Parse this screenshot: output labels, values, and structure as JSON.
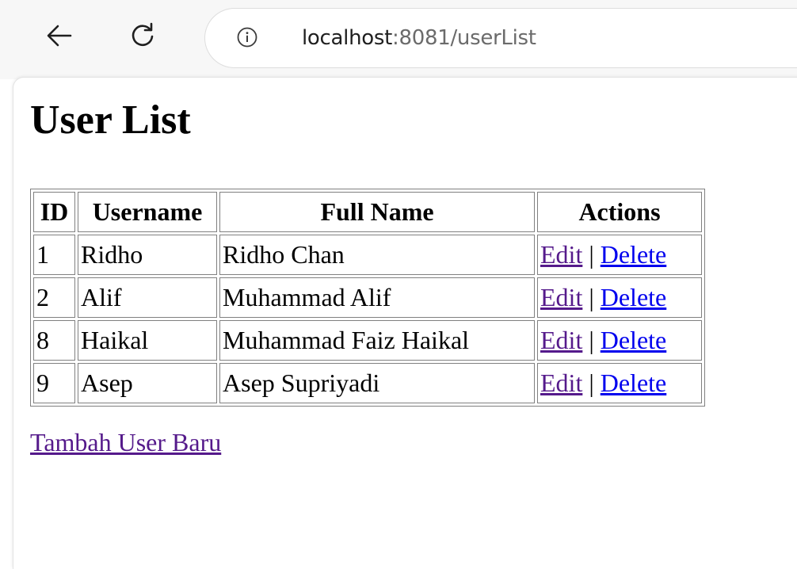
{
  "browser": {
    "url_host": "localhost",
    "url_rest": ":8081/userList"
  },
  "page": {
    "title": "User List",
    "table": {
      "headers": {
        "id": "ID",
        "username": "Username",
        "full_name": "Full Name",
        "actions": "Actions"
      },
      "rows": [
        {
          "id": "1",
          "username": "Ridho",
          "full_name": "Ridho Chan",
          "edit": "Edit",
          "sep": "|",
          "delete": "Delete"
        },
        {
          "id": "2",
          "username": "Alif",
          "full_name": "Muhammad Alif",
          "edit": "Edit",
          "sep": "|",
          "delete": "Delete"
        },
        {
          "id": "8",
          "username": "Haikal",
          "full_name": "Muhammad Faiz Haikal",
          "edit": "Edit",
          "sep": "|",
          "delete": "Delete"
        },
        {
          "id": "9",
          "username": "Asep",
          "full_name": "Asep Supriyadi",
          "edit": "Edit",
          "sep": "|",
          "delete": "Delete"
        }
      ]
    },
    "add_link": "Tambah User Baru"
  },
  "colors": {
    "link": "#0000ee",
    "visited_link": "#551a8b",
    "table_border": "#808080",
    "toolbar_bg": "#f7f7f7"
  },
  "icons": {
    "back": "back-arrow-icon",
    "reload": "reload-icon",
    "info": "info-icon"
  }
}
